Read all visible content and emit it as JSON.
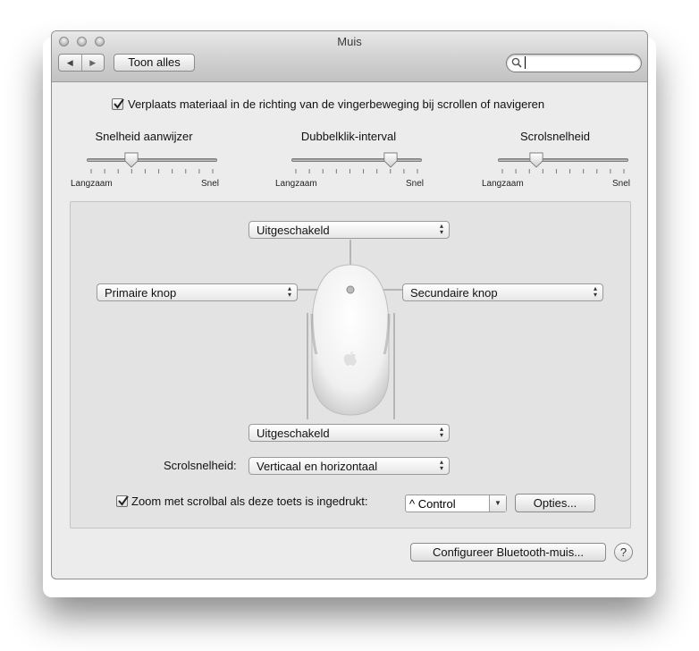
{
  "window": {
    "title": "Muis"
  },
  "toolbar": {
    "back_glyph": "◀",
    "forward_glyph": "▶",
    "show_all_label": "Toon alles",
    "search_placeholder": ""
  },
  "scroll_direction": {
    "label": "Verplaats materiaal in de richting van de vingerbeweging bij scrollen of navigeren",
    "checked": true
  },
  "sliders": [
    {
      "title": "Snelheid aanwijzer",
      "min_label": "Langzaam",
      "max_label": "Snel",
      "value": 0.35
    },
    {
      "title": "Dubbelklik-interval",
      "min_label": "Langzaam",
      "max_label": "Snel",
      "value": 0.77
    },
    {
      "title": "Scrolsnelheid",
      "min_label": "Langzaam",
      "max_label": "Snel",
      "value": 0.3
    }
  ],
  "mouse_panel": {
    "top_button": "Uitgeschakeld",
    "left_button": "Primaire knop",
    "right_button": "Secundaire knop",
    "bottom_button": "Uitgeschakeld",
    "scroll_speed_label": "Scrolsnelheid:",
    "scroll_speed_value": "Verticaal en horizontaal",
    "zoom_label": "Zoom met scrolbal als deze toets is ingedrukt:",
    "zoom_checked": true,
    "zoom_key": "^ Control",
    "options_label": "Opties..."
  },
  "footer": {
    "bluetooth_label": "Configureer Bluetooth-muis...",
    "help_glyph": "?"
  },
  "icons": [
    "close-light",
    "minimize-light",
    "zoom-light",
    "search-icon",
    "checkmark-icon",
    "apple-logo-icon",
    "help-icon"
  ]
}
